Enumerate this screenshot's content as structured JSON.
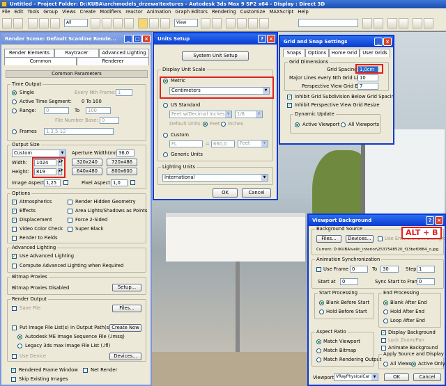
{
  "app": {
    "title": "Untitled   - Project Folder: D:\\KUBA\\archmodels_drzewa\\textures   - Autodesk 3ds Max 9 SP2 x64   - Display : Direct 3D"
  },
  "menu": [
    "File",
    "Edit",
    "Tools",
    "Group",
    "Views",
    "Create",
    "Modifiers",
    "reactor",
    "Animation",
    "Graph Editors",
    "Rendering",
    "Customize",
    "MAXScript",
    "Help"
  ],
  "toolbar": {
    "filter": "All",
    "view": "View"
  },
  "render": {
    "title": "Render Scene: Default Scanline Rende...",
    "tabs": [
      "Render Elements",
      "Raytracer",
      "Advanced Lighting",
      "Common",
      "Renderer"
    ],
    "rollout": "Common Parameters",
    "time": {
      "title": "Time Output",
      "single": "Single",
      "every": "Every Nth Frame:",
      "every_val": "1",
      "active": "Active Time Segment:",
      "active_range": "0 To 100",
      "range": "Range:",
      "from": "0",
      "to_label": "To",
      "to": "100",
      "fnb": "File Number Base:",
      "fnb_val": "0",
      "frames": "Frames",
      "frames_val": "1,3,5-12"
    },
    "size": {
      "title": "Output Size",
      "preset": "Custom",
      "ap_label": "Aperture Width(mm):",
      "ap_val": "36,0",
      "w_label": "Width:",
      "w": "1024",
      "h_label": "Height:",
      "h": "819",
      "presets": [
        "320x240",
        "720x486",
        "640x480",
        "800x600"
      ],
      "ia_label": "Image Aspect:",
      "ia": "1,25",
      "pa_label": "Pixel Aspect:",
      "pa": "1,0"
    },
    "options": {
      "title": "Options",
      "items": [
        "Atmospherics",
        "Render Hidden Geometry",
        "Effects",
        "Area Lights/Shadows as Points",
        "Displacement",
        "Force 2-Sided",
        "Video Color Check",
        "Super Black",
        "Render to Fields"
      ]
    },
    "adv": {
      "title": "Advanced Lighting",
      "use": "Use Advanced Lighting",
      "compute": "Compute Advanced Lighting when Required"
    },
    "bitmap": {
      "title": "Bitmap Proxies",
      "status": "Bitmap Proxies Disabled",
      "setup": "Setup..."
    },
    "out": {
      "title": "Render Output",
      "save": "Save File",
      "files": "Files...",
      "put": "Put Image File List(s) in Output Path(s)",
      "create": "Create Now",
      "autodesk": "Autodesk ME Image Sequence File (.imsq)",
      "legacy": "Legacy 3ds max Image File List (.ifl)",
      "usedev": "Use Device",
      "devices": "Devices..."
    },
    "fw": "Rendered Frame Window",
    "net": "Net Render",
    "skip": "Skip Existing Images"
  },
  "units": {
    "title": "Units Setup",
    "sys": "System Unit Setup",
    "scale": "Display Unit Scale",
    "metric": "Metric",
    "metric_val": "Centimeters",
    "us": "US Standard",
    "us_val": "Feet w/Decimal Inches",
    "us_frac": "1/8",
    "def": "Default Units:",
    "feet": "Feet",
    "inches": "Inches",
    "custom": "Custom",
    "fl": "FL",
    "eq": "=",
    "cval": "660,0",
    "cunit": "Feet",
    "generic": "Generic Units",
    "lighting": "Lighting Units",
    "lighting_val": "International",
    "ok": "OK",
    "cancel": "Cancel"
  },
  "grid": {
    "title": "Grid and Snap Settings",
    "tabs": [
      "Snaps",
      "Options",
      "Home Grid",
      "User Grids"
    ],
    "dim": "Grid Dimensions",
    "spacing": "Grid Spacing:",
    "spacing_val": "1,0cm",
    "major": "Major Lines every Nth Grid Line:",
    "major_val": "10",
    "persp": "Perspective View Grid Extent:",
    "persp_val": "7",
    "inhibit1": "Inhibit Grid Subdivision Below Grid Spacing",
    "inhibit2": "Inhibit Perspective View Grid Resize",
    "dyn": "Dynamic Update",
    "active": "Active Viewport",
    "all": "All Viewports"
  },
  "vb": {
    "title": "Viewport Background",
    "alt": "ALT + B",
    "src": "Background Source",
    "files": "Files...",
    "devices": "Devices...",
    "env": "Use Environment Background",
    "current": "Current:  D:\\KUBA\\velki_interior\\2537548520_f13bef0884_o.jpg",
    "anim": "Animation Synchronization",
    "use_frame": "Use Frame",
    "uf_from": "0",
    "uf_to_label": "To",
    "uf_to": "30",
    "step": "Step",
    "step_val": "1",
    "start_at": "Start at",
    "sa_val": "0",
    "sync": "Sync Start to Frame",
    "sync_val": "0",
    "sp": "Start Processing",
    "blank_before": "Blank Before Start",
    "hold_before": "Hold Before Start",
    "ep": "End Processing",
    "blank_after": "Blank After End",
    "hold_after": "Hold After End",
    "loop": "Loop After End",
    "aspect": "Aspect Ratio",
    "match_vp": "Match Viewport",
    "match_bmp": "Match Bitmap",
    "match_rend": "Match Rendering Output",
    "disp_bg": "Display Background",
    "lock_zoom": "Lock Zoom/Pan",
    "anim_bg": "Animate Background",
    "apply": "Apply Source and Display to",
    "all_views": "All Views",
    "active_only": "Active Only",
    "viewport_label": "Viewport:",
    "viewport_val": "VRayPhysicalCar",
    "ok": "OK",
    "cancel": "Cancel"
  }
}
